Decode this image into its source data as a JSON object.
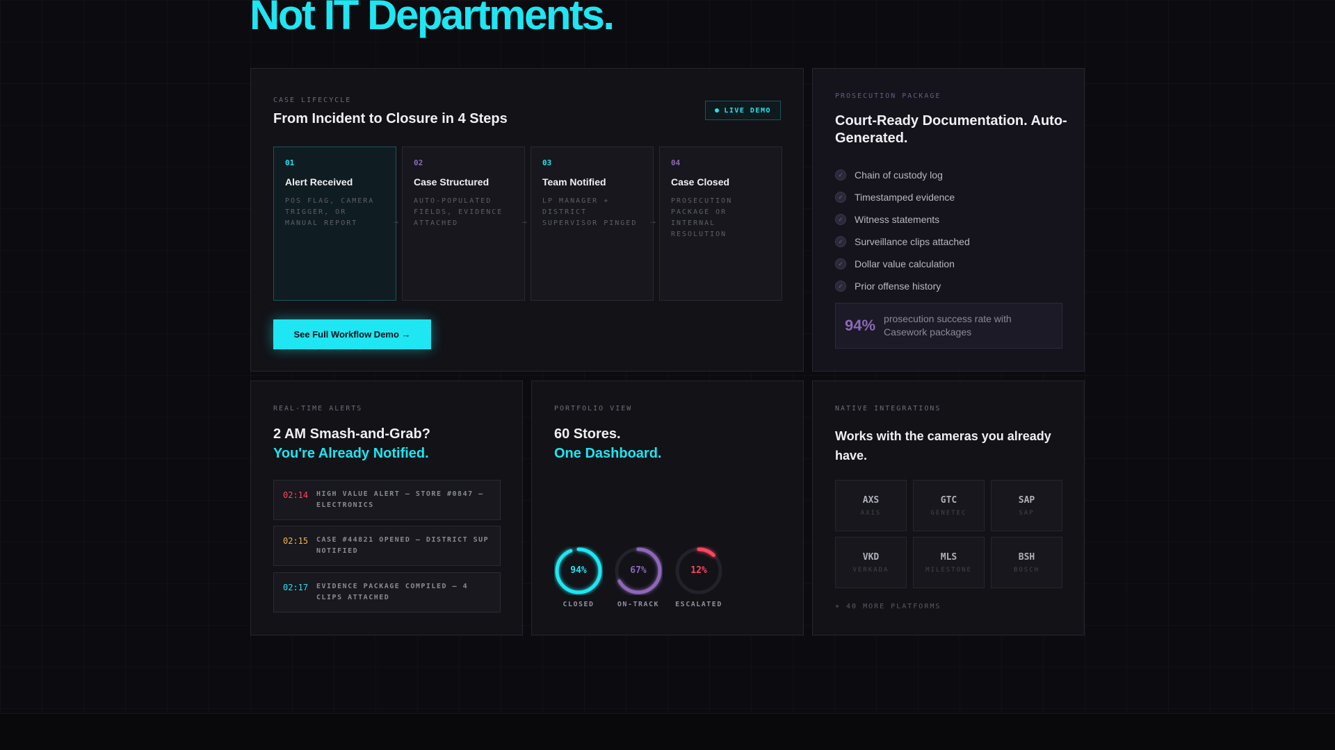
{
  "hero": {
    "title": "Not IT Departments."
  },
  "lifecycle": {
    "eyebrow": "CASE LIFECYCLE",
    "title": "From Incident to Closure in 4 Steps",
    "badge": "LIVE DEMO",
    "steps": [
      {
        "num": "01",
        "title": "Alert Received",
        "desc": "POS FLAG, CAMERA TRIGGER, OR MANUAL REPORT"
      },
      {
        "num": "02",
        "title": "Case Structured",
        "desc": "AUTO-POPULATED FIELDS, EVIDENCE ATTACHED"
      },
      {
        "num": "03",
        "title": "Team Notified",
        "desc": "LP MANAGER + DISTRICT SUPERVISOR PINGED"
      },
      {
        "num": "04",
        "title": "Case Closed",
        "desc": "PROSECUTION PACKAGE OR INTERNAL RESOLUTION"
      }
    ],
    "cta": "See Full Workflow Demo →"
  },
  "prosecution": {
    "eyebrow": "PROSECUTION PACKAGE",
    "title": "Court-Ready Documentation. Auto-Generated.",
    "items": [
      "Chain of custody log",
      "Timestamped evidence",
      "Witness statements",
      "Surveillance clips attached",
      "Dollar value calculation",
      "Prior offense history"
    ],
    "stat_value": "94%",
    "stat_text": "prosecution success rate with Casework packages"
  },
  "alerts": {
    "eyebrow": "REAL-TIME ALERTS",
    "title_line1": "2 AM Smash-and-Grab?",
    "title_line2": "You're Already Notified.",
    "rows": [
      {
        "time": "02:14",
        "text": "HIGH VALUE ALERT — STORE #0847 — ELECTRONICS",
        "color": "#ff4560"
      },
      {
        "time": "02:15",
        "text": "CASE #44821 OPENED — DISTRICT SUP NOTIFIED",
        "color": "#f5b642"
      },
      {
        "time": "02:17",
        "text": "EVIDENCE PACKAGE COMPILED — 4 CLIPS ATTACHED",
        "color": "#1ee6f2"
      }
    ]
  },
  "portfolio": {
    "eyebrow": "PORTFOLIO VIEW",
    "title_line1": "60 Stores.",
    "title_line2": "One Dashboard.",
    "rings": [
      {
        "value_text": "94%",
        "fraction": 0.94,
        "label": "CLOSED",
        "color": "#1ee6f2"
      },
      {
        "value_text": "67%",
        "fraction": 0.67,
        "label": "ON-TRACK",
        "color": "#8d68b8"
      },
      {
        "value_text": "12%",
        "fraction": 0.12,
        "label": "ESCALATED",
        "color": "#ff4560"
      }
    ]
  },
  "integrations": {
    "eyebrow": "NATIVE INTEGRATIONS",
    "title": "Works with the cameras you already have.",
    "logos": [
      {
        "code": "AXS",
        "name": "AXIS"
      },
      {
        "code": "GTC",
        "name": "GENETEC"
      },
      {
        "code": "SAP",
        "name": "SAP"
      },
      {
        "code": "VKD",
        "name": "VERKADA"
      },
      {
        "code": "MLS",
        "name": "MILESTONE"
      },
      {
        "code": "BSH",
        "name": "BOSCH"
      }
    ],
    "more": "+ 40 MORE PLATFORMS"
  },
  "colors": {
    "accent": "#1ee6f2",
    "purple": "#8d68b8",
    "danger": "#ff4560",
    "warning": "#f5b642"
  }
}
